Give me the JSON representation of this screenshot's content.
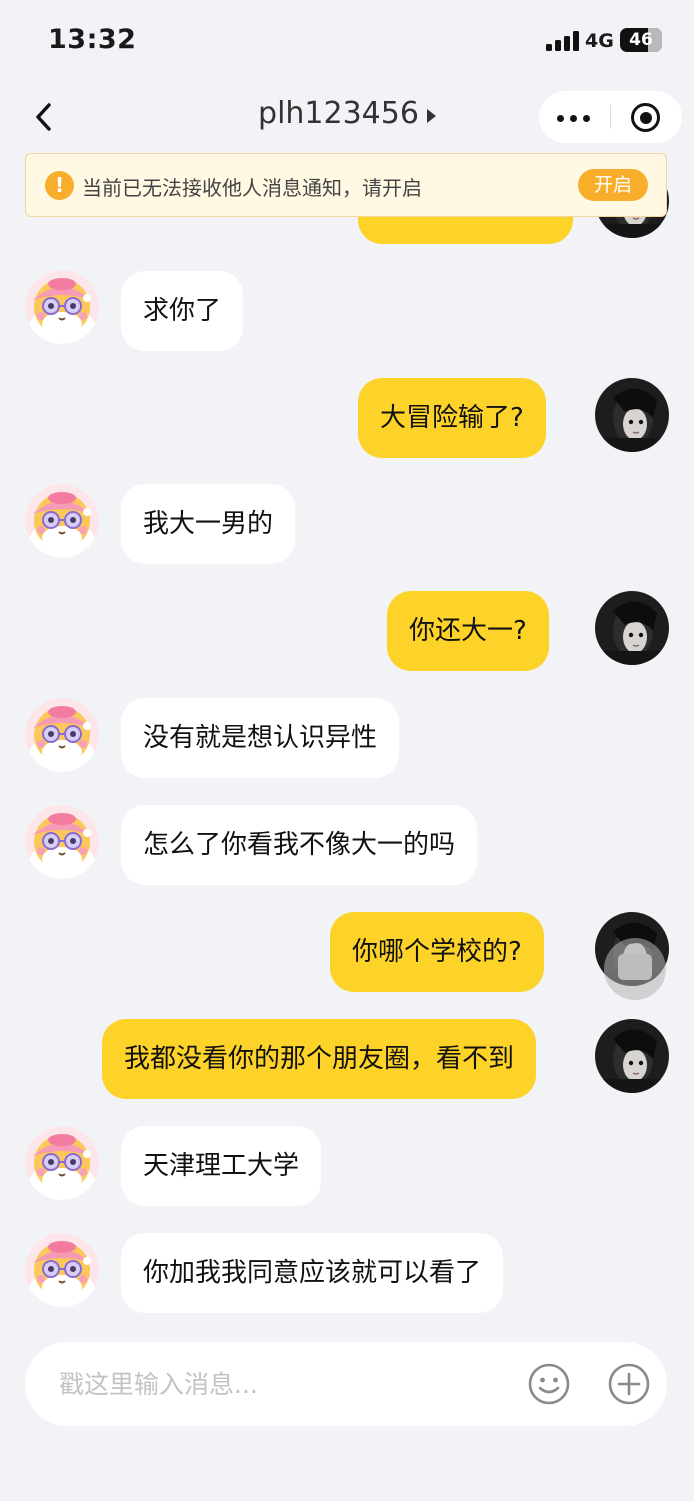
{
  "status_bar": {
    "time": "13:32",
    "network": "4G",
    "battery": "46"
  },
  "nav": {
    "title": "plh123456"
  },
  "notice": {
    "text": "当前已无法接收他人消息通知，请开启",
    "button": "开启"
  },
  "colors": {
    "outgoing_bubble": "#fdd329",
    "incoming_bubble": "#ffffff",
    "notice_accent": "#f8ae2b",
    "background": "#f2f3f7"
  },
  "messages": [
    {
      "side": "out",
      "text": ""
    },
    {
      "side": "in",
      "text": "求你了"
    },
    {
      "side": "out",
      "text": "大冒险输了?"
    },
    {
      "side": "in",
      "text": "我大一男的"
    },
    {
      "side": "out",
      "text": "你还大一?"
    },
    {
      "side": "in",
      "text": "没有就是想认识异性"
    },
    {
      "side": "in",
      "text": "怎么了你看我不像大一的吗"
    },
    {
      "side": "out",
      "text": "你哪个学校的?"
    },
    {
      "side": "out",
      "text": "我都没看你的那个朋友圈，看不到"
    },
    {
      "side": "in",
      "text": "天津理工大学"
    },
    {
      "side": "in",
      "text": "你加我我同意应该就可以看了"
    }
  ],
  "input": {
    "placeholder": "戳这里输入消息..."
  },
  "icons": [
    "back-arrow-icon",
    "more-dots-icon",
    "record-icon",
    "warning-icon",
    "emoji-icon",
    "plus-icon",
    "floating-chat-icon"
  ]
}
